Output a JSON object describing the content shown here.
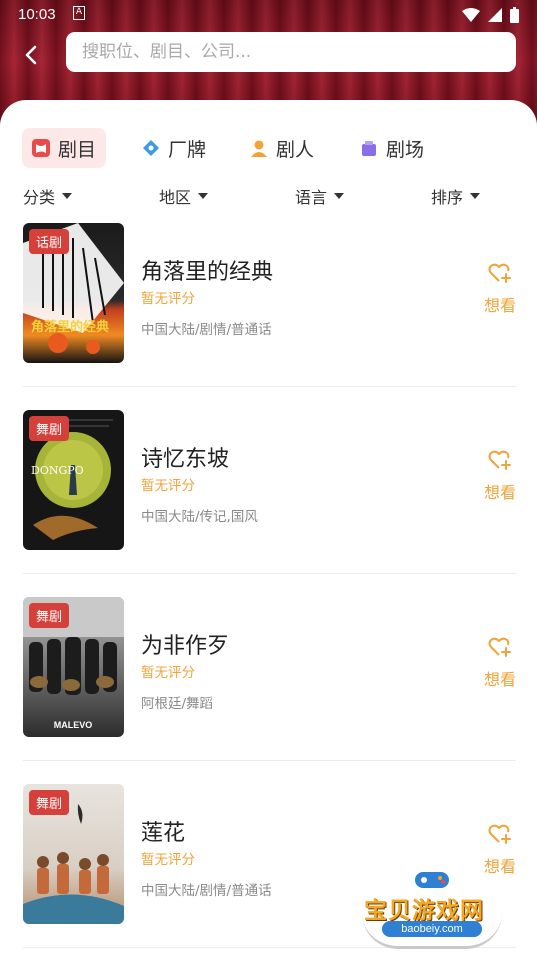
{
  "status_bar": {
    "time": "10:03",
    "a_label": "A"
  },
  "search": {
    "placeholder": "搜职位、剧目、公司..."
  },
  "tabs": [
    {
      "label": "剧目",
      "icon": "theater-icon",
      "active": true
    },
    {
      "label": "厂牌",
      "icon": "tag-icon",
      "active": false
    },
    {
      "label": "剧人",
      "icon": "person-icon",
      "active": false
    },
    {
      "label": "剧场",
      "icon": "venue-icon",
      "active": false
    }
  ],
  "filters": [
    {
      "label": "分类"
    },
    {
      "label": "地区"
    },
    {
      "label": "语言"
    },
    {
      "label": "排序"
    }
  ],
  "items": [
    {
      "badge": "话剧",
      "title": "角落里的经典",
      "rating": "暂无评分",
      "meta": "中国大陆/剧情/普通话",
      "want_label": "想看"
    },
    {
      "badge": "舞剧",
      "title": "诗忆东坡",
      "rating": "暂无评分",
      "meta": "中国大陆/传记,国风",
      "want_label": "想看"
    },
    {
      "badge": "舞剧",
      "title": "为非作歹",
      "rating": "暂无评分",
      "meta": "阿根廷/舞蹈",
      "want_label": "想看"
    },
    {
      "badge": "舞剧",
      "title": "莲花",
      "rating": "暂无评分",
      "meta": "中国大陆/剧情/普通话",
      "want_label": "想看"
    }
  ],
  "posters": {
    "poster1_text": "角落里的经典",
    "poster2_text": "DONGPO",
    "poster3_text": "MALEVO"
  },
  "watermark": {
    "text": "宝贝游戏网",
    "url": "baobeiy.com"
  },
  "colors": {
    "accent": "#f0a43a",
    "badge": "#d6403b",
    "active_tab_bg": "#fde8e8",
    "header": "#8e1322"
  }
}
